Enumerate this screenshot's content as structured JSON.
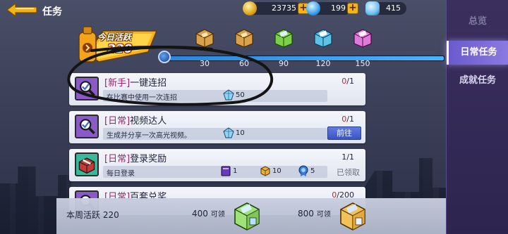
{
  "header": {
    "title": "任务",
    "currencies": [
      {
        "name": "gold",
        "value": "23735",
        "icon": "gold-coin-icon"
      },
      {
        "name": "diamond",
        "value": "199",
        "icon": "blue-gem-icon"
      },
      {
        "name": "crystal",
        "value": "415",
        "icon": "crystal-icon"
      }
    ],
    "plus": "+"
  },
  "sidenav": {
    "items": [
      {
        "label": "总览"
      },
      {
        "label": "日常任务"
      },
      {
        "label": "成就任务"
      }
    ]
  },
  "activity": {
    "title": "今日活跃",
    "value": "220",
    "progress_fraction": 1.0,
    "milestones": [
      "30",
      "60",
      "90",
      "120",
      "150"
    ]
  },
  "tasks": [
    {
      "tag": "[新手]",
      "name": "一键连招",
      "desc": "在比赛中使用一次连招",
      "progress_cur": "0",
      "progress_total": "/1",
      "rewards": [
        {
          "icon": "crystal-icon",
          "amount": "50"
        }
      ]
    },
    {
      "tag": "[日常]",
      "name": "视频达人",
      "desc": "生成并分享一次高光视频。",
      "progress_cur": "0",
      "progress_total": "/1",
      "rewards": [
        {
          "icon": "crystal-icon",
          "amount": "10"
        }
      ],
      "button": "前往"
    },
    {
      "tag": "[日常]",
      "name": "登录奖励",
      "desc": "每日登录",
      "progress_cur": "1",
      "progress_total": "/1",
      "rewards": [
        {
          "icon": "purple-book-icon",
          "amount": "1"
        },
        {
          "icon": "gold-box-icon",
          "amount": "10"
        },
        {
          "icon": "blue-medal-icon",
          "amount": "5"
        }
      ],
      "status": "已领取"
    },
    {
      "tag": "[日常]",
      "name": "百套兑奖",
      "progress_cur": "0",
      "progress_total": "/200"
    }
  ],
  "weekly": {
    "label": "本周活跃 220",
    "items": [
      {
        "amount": "400",
        "suffix": "可领"
      },
      {
        "amount": "800",
        "suffix": "可领"
      }
    ]
  },
  "colors": {
    "accent": "#6a5acd",
    "tag": "#a0226a",
    "progress_incomplete": "#d0202a",
    "go_button": "#4a66d4"
  }
}
